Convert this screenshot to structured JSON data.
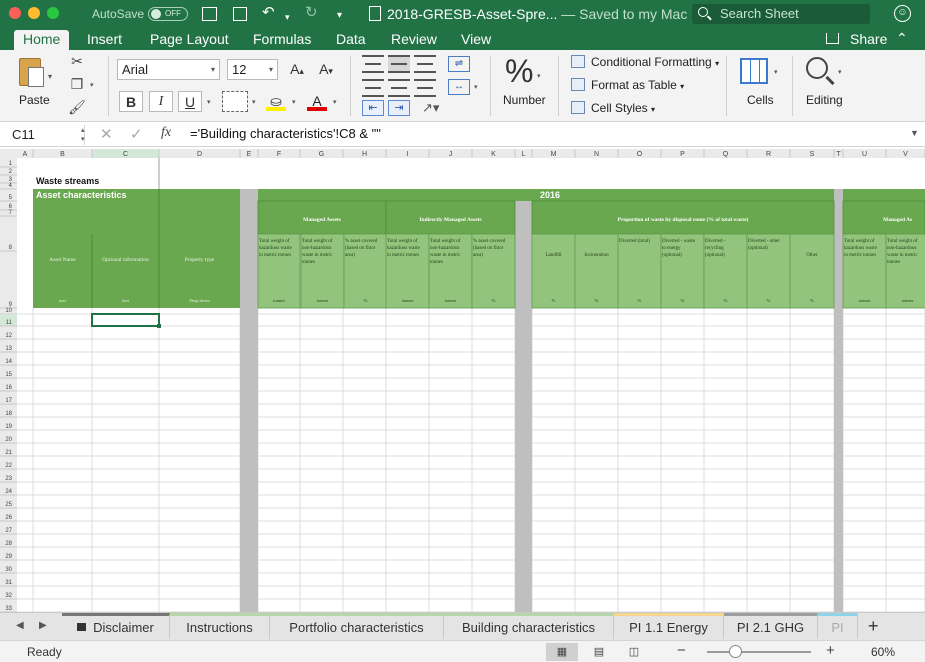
{
  "titlebar": {
    "autosave_label": "AutoSave",
    "autosave_state": "OFF",
    "doc_title": "2018-GRESB-Asset-Spre...",
    "doc_status": " — Saved to my Mac",
    "search_placeholder": "Search Sheet"
  },
  "ribbon_tabs": [
    "Home",
    "Insert",
    "Page Layout",
    "Formulas",
    "Data",
    "Review",
    "View"
  ],
  "share_label": "Share",
  "ribbon": {
    "paste_label": "Paste",
    "font_name": "Arial",
    "font_size": "12",
    "bold": "B",
    "italic": "I",
    "underline": "U",
    "number_label": "Number",
    "conditional_formatting": "Conditional Formatting",
    "format_as_table": "Format as Table",
    "cell_styles": "Cell Styles",
    "cells_label": "Cells",
    "editing_label": "Editing"
  },
  "formula_bar": {
    "name_box": "C11",
    "formula": "='Building characteristics'!C8 & \"\""
  },
  "sheet": {
    "columns": [
      "A",
      "B",
      "C",
      "D",
      "E",
      "F",
      "G",
      "H",
      "I",
      "J",
      "K",
      "L",
      "M",
      "N",
      "O",
      "P",
      "Q",
      "R",
      "S",
      "T",
      "U",
      "V"
    ],
    "rows": [
      "1",
      "2",
      "3",
      "4",
      "5",
      "6",
      "7",
      "8",
      "9",
      "10",
      "11",
      "12",
      "13",
      "14",
      "15",
      "16",
      "17",
      "18",
      "19",
      "20",
      "21",
      "22",
      "23",
      "24",
      "25",
      "26",
      "27",
      "28",
      "29",
      "30",
      "31",
      "32",
      "33"
    ],
    "title": "Waste streams",
    "asset_characteristics": "Asset characteristics",
    "year": "2016",
    "managed_assets": "Managed Assets",
    "indirectly_managed": "Indirectly Managed Assets",
    "proportion_waste": "Proportion of waste by disposal route (% of total waste)",
    "managed_assets_cont": "Managed As",
    "asset_cols": [
      {
        "label": "Asset Name",
        "unit": "text"
      },
      {
        "label": "Optional information",
        "unit": "text"
      },
      {
        "label": "Property type",
        "unit": "Drop down"
      }
    ],
    "weight_cols": [
      {
        "label": "Total weight of hazardous waste in metric tonnes",
        "unit": "tonnes"
      },
      {
        "label": "Total weight of non-hazardous waste in metric tonnes",
        "unit": "tonnes"
      },
      {
        "label": "% asset covered (based on floor area)",
        "unit": "%"
      }
    ],
    "disposal_cols": [
      {
        "label": "Landfill",
        "unit": "%"
      },
      {
        "label": "Incineration",
        "unit": "%"
      },
      {
        "label": "Diverted (total)",
        "unit": "%"
      },
      {
        "label": "Diverted - waste to energy (optional)",
        "unit": "%"
      },
      {
        "label": "Diverted - recycling (optional)",
        "unit": "%"
      },
      {
        "label": "Diverted - other (optional)",
        "unit": "%"
      },
      {
        "label": "Other",
        "unit": "%"
      }
    ],
    "cont_cols": [
      {
        "label": "Total weight of hazardous waste in metric tonnes",
        "unit": "tonnes"
      },
      {
        "label": "Total weight of non-hazardous waste in metric tonnes",
        "unit": "tonnes"
      }
    ]
  },
  "sheet_tabs": [
    {
      "label": "Disclaimer",
      "color": "#777777"
    },
    {
      "label": "Instructions",
      "color": "#b6d7a8"
    },
    {
      "label": "Portfolio characteristics",
      "color": "#b6d7a8"
    },
    {
      "label": "Building characteristics",
      "color": "#b6d7a8"
    },
    {
      "label": "PI 1.1 Energy",
      "color": "#f6d58f"
    },
    {
      "label": "PI 2.1 GHG",
      "color": "#9e9e9e"
    },
    {
      "label": "PI",
      "color": "#8fd3e8"
    }
  ],
  "status": {
    "text": "Ready",
    "zoom": "60%"
  },
  "colors": {
    "excel_green": "#217346",
    "header_green": "#6aa84f",
    "subheader_green": "#93c47d",
    "separator_gray": "#bfbfbf"
  }
}
